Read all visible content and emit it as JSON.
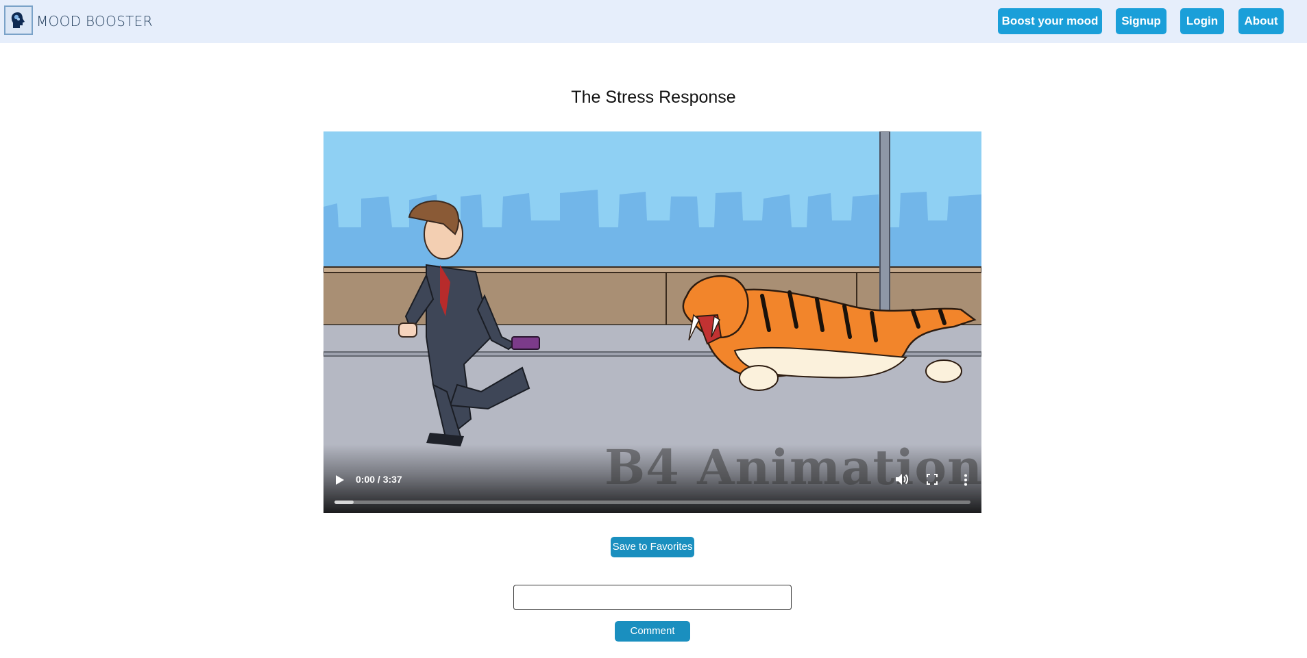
{
  "navbar": {
    "brand": "MOOD BOOSTER",
    "logo_icon": "brain-head-icon",
    "links": [
      {
        "label": "Boost your mood"
      },
      {
        "label": "Signup"
      },
      {
        "label": "Login"
      },
      {
        "label": "About"
      }
    ]
  },
  "page": {
    "title": "The Stress Response"
  },
  "video": {
    "time_display": "0:00 / 3:37",
    "watermark": "B4 Animation",
    "progress_buffered": 0.03,
    "icons": [
      "play-icon",
      "volume-icon",
      "fullscreen-icon",
      "more-options-icon"
    ]
  },
  "actions": {
    "save_label": "Save to Favorites",
    "comment_placeholder": "",
    "comment_button": "Comment"
  },
  "colors": {
    "nav_background": "#e6eefb",
    "button_blue": "#1a9fd9",
    "action_blue": "#1a8fbf"
  }
}
